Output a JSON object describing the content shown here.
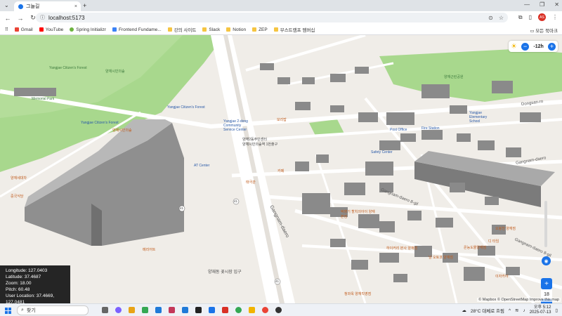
{
  "browser": {
    "tab_title": "그늘길",
    "tab_close": "×",
    "new_tab": "+",
    "url": "localhost:5173",
    "bookmarks": [
      {
        "label": "Gmail",
        "color": "#ea4335"
      },
      {
        "label": "YouTube",
        "color": "#ff0000"
      },
      {
        "label": "Spring Initializr",
        "color": "#6db33f"
      },
      {
        "label": "Frontend Fundame...",
        "color": "#3b82f6"
      },
      {
        "label": "강의 사이트",
        "color": "#f5c542"
      },
      {
        "label": "Slack",
        "color": "#f5c542"
      },
      {
        "label": "Notion",
        "color": "#f5c542"
      },
      {
        "label": "ZEP",
        "color": "#f5c542"
      },
      {
        "label": "부스트캠프 멤버십",
        "color": "#f5c542"
      }
    ],
    "all_bookmarks": "모든 북마크"
  },
  "map": {
    "time_control": {
      "value": "-12h",
      "minus": "−",
      "plus": "+"
    },
    "zoom_control": {
      "plus": "+",
      "value": "18",
      "minus": "−"
    },
    "info": {
      "longitude": "Longitude: 127.0403",
      "latitude": "Latitude: 37.4687",
      "zoom": "Zoom: 18.00",
      "pitch": "Pitch: 60.48",
      "user_location": "User Location: 37.4669, 127.0481"
    },
    "attribution": "© Mapbox  © OpenStreetMap  Improve this map",
    "logo": "© mapbox",
    "roads": [
      "Gangnam-daero",
      "Gangnam-daero 8-gil",
      "Dongsan-ro",
      "Gangnam-daero",
      "Gangnam-daero 8-gil"
    ],
    "labels": [
      {
        "t": "Yangjae Citizen's Forest",
        "c": "g"
      },
      {
        "t": "양재시민의숲",
        "c": "g"
      },
      {
        "t": "Memorial Park",
        "c": "g"
      },
      {
        "t": "Yangjae Citizen's Forest",
        "c": "b"
      },
      {
        "t": "Yangjae Citizen's Forest",
        "c": "b"
      },
      {
        "t": "Yangjae 2-dong Community Service Center",
        "c": "b"
      },
      {
        "t": "양재2동주민센터",
        "c": "k"
      },
      {
        "t": "양재시민의숲역 1번출구",
        "c": "k"
      },
      {
        "t": "Post Office",
        "c": "b"
      },
      {
        "t": "Fire Station",
        "c": "b"
      },
      {
        "t": "Yangjae Elementary School",
        "c": "b"
      },
      {
        "t": "Safety Center",
        "c": "b"
      },
      {
        "t": "AT Center",
        "c": "b"
      },
      {
        "t": "양재근린공원",
        "c": "g"
      },
      {
        "t": "양재동 꽃시장 입구",
        "c": "k"
      },
      {
        "t": "하이커리 본사 양재점",
        "c": "o"
      },
      {
        "t": "남 오토코 양재점",
        "c": "o"
      },
      {
        "t": "온능도몰양재점",
        "c": "o"
      },
      {
        "t": "디 타임",
        "c": "o"
      },
      {
        "t": "오붕천 양재점",
        "c": "o"
      },
      {
        "t": "이자카야",
        "c": "o"
      },
      {
        "t": "청와옥 양재직영점",
        "c": "o"
      },
      {
        "t": "박향기 할치의아이 양재본점",
        "c": "o"
      },
      {
        "t": "양재세대차",
        "c": "o"
      },
      {
        "t": "중국식당",
        "c": "o"
      },
      {
        "t": "메리어트",
        "c": "o"
      },
      {
        "t": "카페",
        "c": "o"
      },
      {
        "t": "양재시민의숲",
        "c": "o"
      },
      {
        "t": "보리밥",
        "c": "o"
      },
      {
        "t": "태극관",
        "c": "o"
      }
    ],
    "route_numbers": [
      "41",
      "41",
      "41"
    ]
  },
  "taskbar": {
    "search": "찾기",
    "weather": "28°C 대체로 흐림",
    "time": "오후 5:12",
    "date": "2025-07-13"
  }
}
